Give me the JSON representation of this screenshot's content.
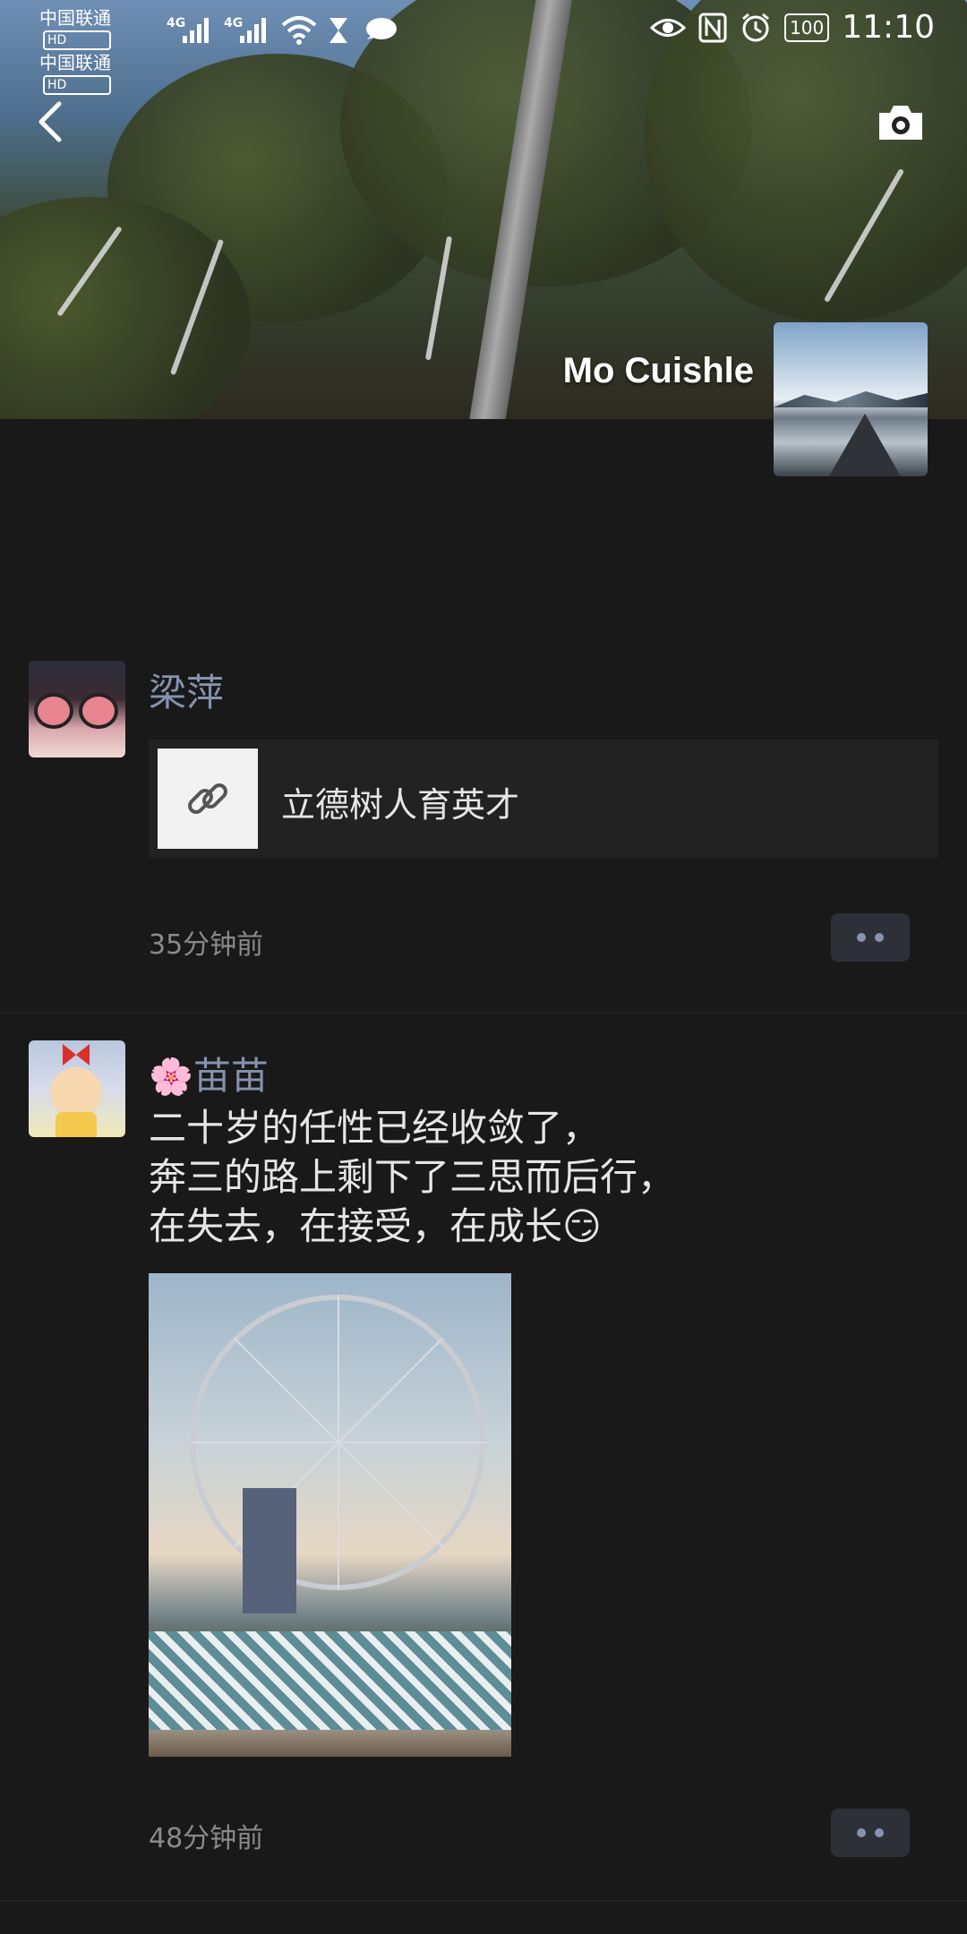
{
  "status_bar": {
    "carrier1": "中国联通",
    "carrier2": "中国联通",
    "hd": "HD",
    "net1": "4G",
    "net2": "4G",
    "battery": "100",
    "time": "11:10"
  },
  "header": {
    "back_icon": "chevron-left-icon",
    "camera_icon": "camera-icon",
    "username": "Mo Cuishle"
  },
  "posts": [
    {
      "author": "梁萍",
      "link_title": "立德树人育英才",
      "time": "35分钟前"
    },
    {
      "author_prefix": "🌸",
      "author": "苗苗",
      "text": "二十岁的任性已经收敛了，\n奔三的路上剩下了三思而后行，\n在失去，在接受，在成长😏",
      "time": "48分钟前"
    }
  ],
  "colors": {
    "background": "#191919",
    "name_accent": "#8792b0",
    "timestamp": "#8a8a8a"
  }
}
